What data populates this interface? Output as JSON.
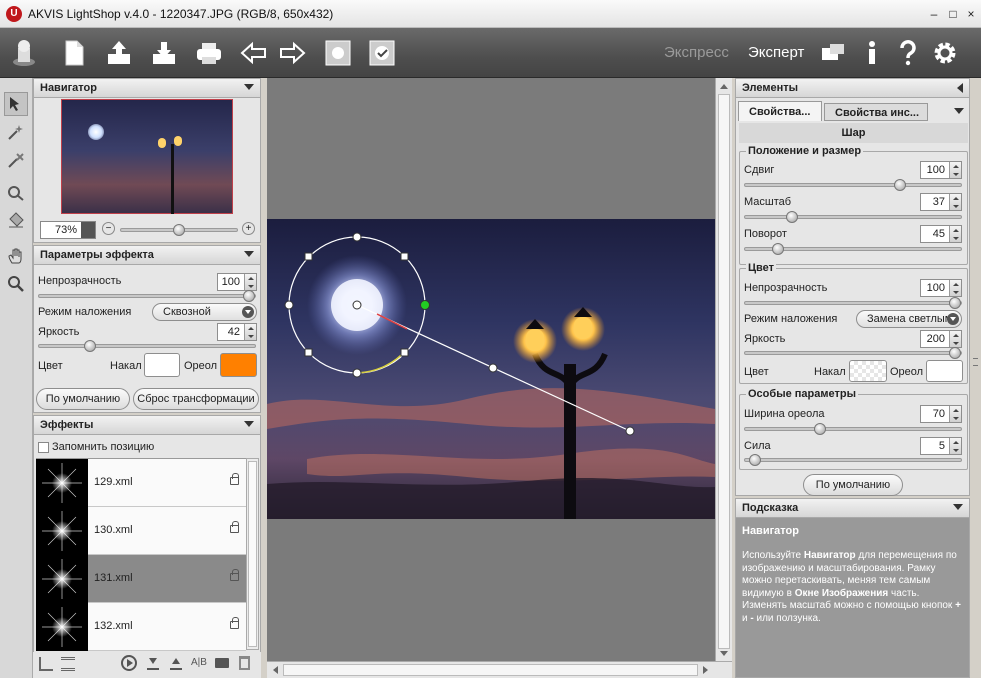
{
  "app": {
    "title": "AKVIS LightShop v.4.0 - 1220347.JPG (RGB/8, 650x432)",
    "logo_letter": "U",
    "window_controls": [
      "–",
      "□",
      "×"
    ]
  },
  "toolbar": {
    "buttons": [
      "home-icon",
      "new-icon",
      "open-icon",
      "save-icon",
      "print-icon",
      "undo-icon",
      "redo-icon",
      "run-icon",
      "apply-icon"
    ],
    "mode_express": "Экспресс",
    "mode_expert": "Эксперт",
    "right_icons": [
      "panels-icon",
      "info-icon",
      "help-icon",
      "settings-icon"
    ]
  },
  "navigator": {
    "title": "Навигатор",
    "zoom": "73%",
    "zoom_minus": "−",
    "zoom_plus": "+"
  },
  "effect_params": {
    "title": "Параметры эффекта",
    "opacity_label": "Непрозрачность",
    "opacity_value": "100",
    "opacity_fraction": 1.0,
    "blend_label": "Режим наложения",
    "blend_value": "Сквозной",
    "brightness_label": "Яркость",
    "brightness_value": "42",
    "brightness_fraction": 0.22,
    "color_label": "Цвет",
    "glow_label": "Накал",
    "halo_label": "Ореол",
    "glow_color": "#ffffff",
    "halo_color": "#ff8000",
    "default_button": "По умолчанию",
    "reset_button": "Сброс трансформации"
  },
  "effects": {
    "title": "Эффекты",
    "remember_label": "Запомнить позицию",
    "items": [
      {
        "name": "129.xml",
        "selected": false
      },
      {
        "name": "130.xml",
        "selected": false
      },
      {
        "name": "131.xml",
        "selected": true
      },
      {
        "name": "132.xml",
        "selected": false
      }
    ],
    "bottom_icons": [
      "tree-icon",
      "list-icon",
      "play-icon",
      "import-icon",
      "export-icon",
      "compare-icon",
      "folder-icon",
      "trash-icon"
    ],
    "compare_text": "A|B"
  },
  "elements": {
    "title": "Элементы",
    "tab_props": "Свойства...",
    "tab_tool_props": "Свойства инс...",
    "element_name": "Шар",
    "position_group": "Положение и размер",
    "shift_label": "Сдвиг",
    "shift_value": "100",
    "shift_fraction": 0.73,
    "scale_label": "Масштаб",
    "scale_value": "37",
    "scale_fraction": 0.2,
    "rotate_label": "Поворот",
    "rotate_value": "45",
    "rotate_fraction": 0.13,
    "color_group": "Цвет",
    "opacity_label": "Непрозрачность",
    "opacity_value": "100",
    "opacity_fraction": 1.0,
    "blend_label": "Режим наложения",
    "blend_value": "Замена светлым",
    "brightness_label": "Яркость",
    "brightness_value": "200",
    "brightness_fraction": 1.0,
    "color_label": "Цвет",
    "glow_label": "Накал",
    "halo_label": "Ореол",
    "halo_color": "#ffffff",
    "special_group": "Особые параметры",
    "halo_width_label": "Ширина ореола",
    "halo_width_value": "70",
    "halo_width_fraction": 0.34,
    "strength_label": "Сила",
    "strength_value": "5",
    "strength_fraction": 0.02,
    "default_button": "По умолчанию"
  },
  "hint": {
    "title": "Подсказка",
    "heading": "Навигатор",
    "p1": "Используйте ",
    "b1": "Навигатор",
    "p2": " для перемещения по изображению и масштабирования. Рамку можно перетаскивать, меняя тем самым видимую в ",
    "b2": "Окне Изображения",
    "p3": " часть. Изменять масштаб можно с помощью кнопок ",
    "b3": "+",
    "p4": " и ",
    "b4": "-",
    "p5": " или ползунка."
  },
  "colors": {
    "toolbar_bg": "#4e4e4e",
    "canvas_bg": "#7b7b7b",
    "selected_effect": "#8a8a8a",
    "control_point_active": "#22cc22"
  }
}
